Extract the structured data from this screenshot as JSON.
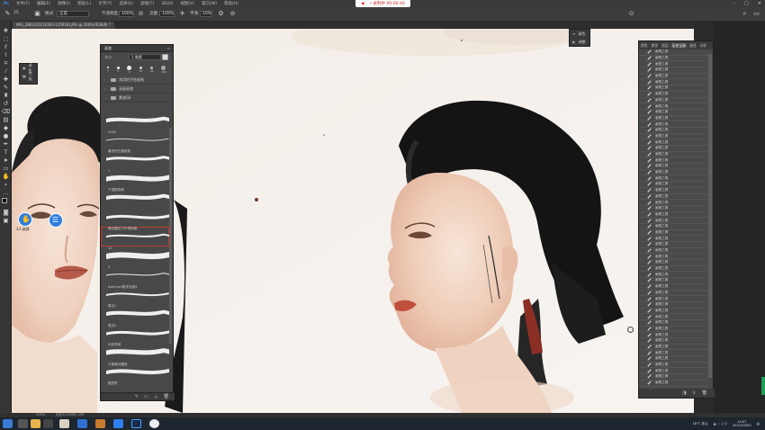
{
  "menubar": {
    "items": [
      "文件(F)",
      "编辑(E)",
      "图像(I)",
      "图层(L)",
      "文字(Y)",
      "选择(S)",
      "滤镜(T)",
      "3D(D)",
      "视图(V)",
      "窗口(W)",
      "帮助(H)"
    ],
    "recording": {
      "logo": "◀",
      "text": "• 录制中 00:06:40"
    }
  },
  "options": {
    "brush_size": "25",
    "mode_label": "模式:",
    "mode_value": "正常",
    "opacity_label": "不透明度:",
    "opacity_value": "100%",
    "flow_label": "流量:",
    "flow_value": "100%",
    "smooth_label": "平滑:",
    "smooth_value": "10%"
  },
  "doc_tab": {
    "title": "IMG_2862(20210303-135918).JPG @ 300%(RGB/8) *"
  },
  "mini_panel_a": {
    "items": [
      {
        "icon": "eye-icon",
        "label": "调色"
      },
      {
        "icon": "grid-icon",
        "label": "色板"
      }
    ]
  },
  "mini_panel_b": {
    "items": [
      {
        "icon": "layers-icon",
        "label": "调色"
      },
      {
        "icon": "circle-half-icon",
        "label": "调整"
      }
    ]
  },
  "brush_panel": {
    "title": "画笔",
    "size_label": "大小:",
    "size_value": "1 像素",
    "preset_sizes": [
      "1",
      "5",
      "9",
      "30",
      "45",
      "180"
    ],
    "folders": [
      "常用的手绘画笔",
      "油画画笔",
      "素描SB"
    ],
    "brushes": [
      {
        "name": ""
      },
      {
        "name": "5000"
      },
      {
        "name": "最贵的石墨铅笔"
      },
      {
        "name": "1"
      },
      {
        "name": "干湿粗笔刷"
      },
      {
        "name": ""
      },
      {
        "name": "硬边圆压力不透明度"
      },
      {
        "name": "10"
      },
      {
        "name": "3"
      },
      {
        "name": "KwBrush数学加强4"
      },
      {
        "name": "柔边1"
      },
      {
        "name": "柔边2"
      },
      {
        "name": "动态笔刷"
      },
      {
        "name": "万能硬边圆笔"
      },
      {
        "name": "图层笔"
      },
      {
        "name": "自动平边"
      },
      {
        "name": "调整"
      }
    ]
  },
  "history_panel": {
    "tabs": [
      "颜色",
      "属性",
      "图层",
      "历史记录",
      "路径",
      "动作"
    ],
    "active_tab": "历史记录",
    "item_label": "画笔工具",
    "item_count": 56
  },
  "status": {
    "zoom": "300%",
    "doc": "文档:6.12M/6.12M"
  },
  "avatar_label": "3人录屏",
  "tray": {
    "weather": "18°C 多云",
    "time": "14:07",
    "date": "2021/03/03"
  },
  "colors": {
    "accent_red": "#c23a2a",
    "canvas": "#f4f1ee",
    "panel": "#484848",
    "selection_blue": "#2f7fe0"
  }
}
